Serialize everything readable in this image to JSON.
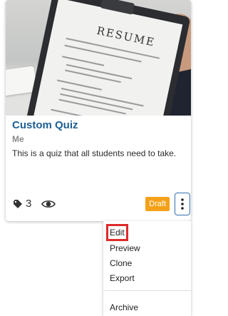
{
  "card": {
    "thumbnail_text": "RESUME",
    "title": "Custom Quiz",
    "author": "Me",
    "description": "This is a quiz that all students need to take.",
    "tag_icon": "tag-icon",
    "tag_count": "3",
    "visibility_icon": "eye-icon",
    "status_badge": "Draft",
    "status_color": "#f4a11a",
    "menu_icon": "kebab-menu-icon"
  },
  "menu": {
    "items": [
      "Edit",
      "Preview",
      "Clone",
      "Export"
    ],
    "archive": "Archive",
    "highlighted_item": "Edit",
    "highlight_color": "#de2a2a"
  },
  "colors": {
    "title": "#1c5f94",
    "badge": "#f4a11a",
    "focus": "#2f6fb0"
  }
}
